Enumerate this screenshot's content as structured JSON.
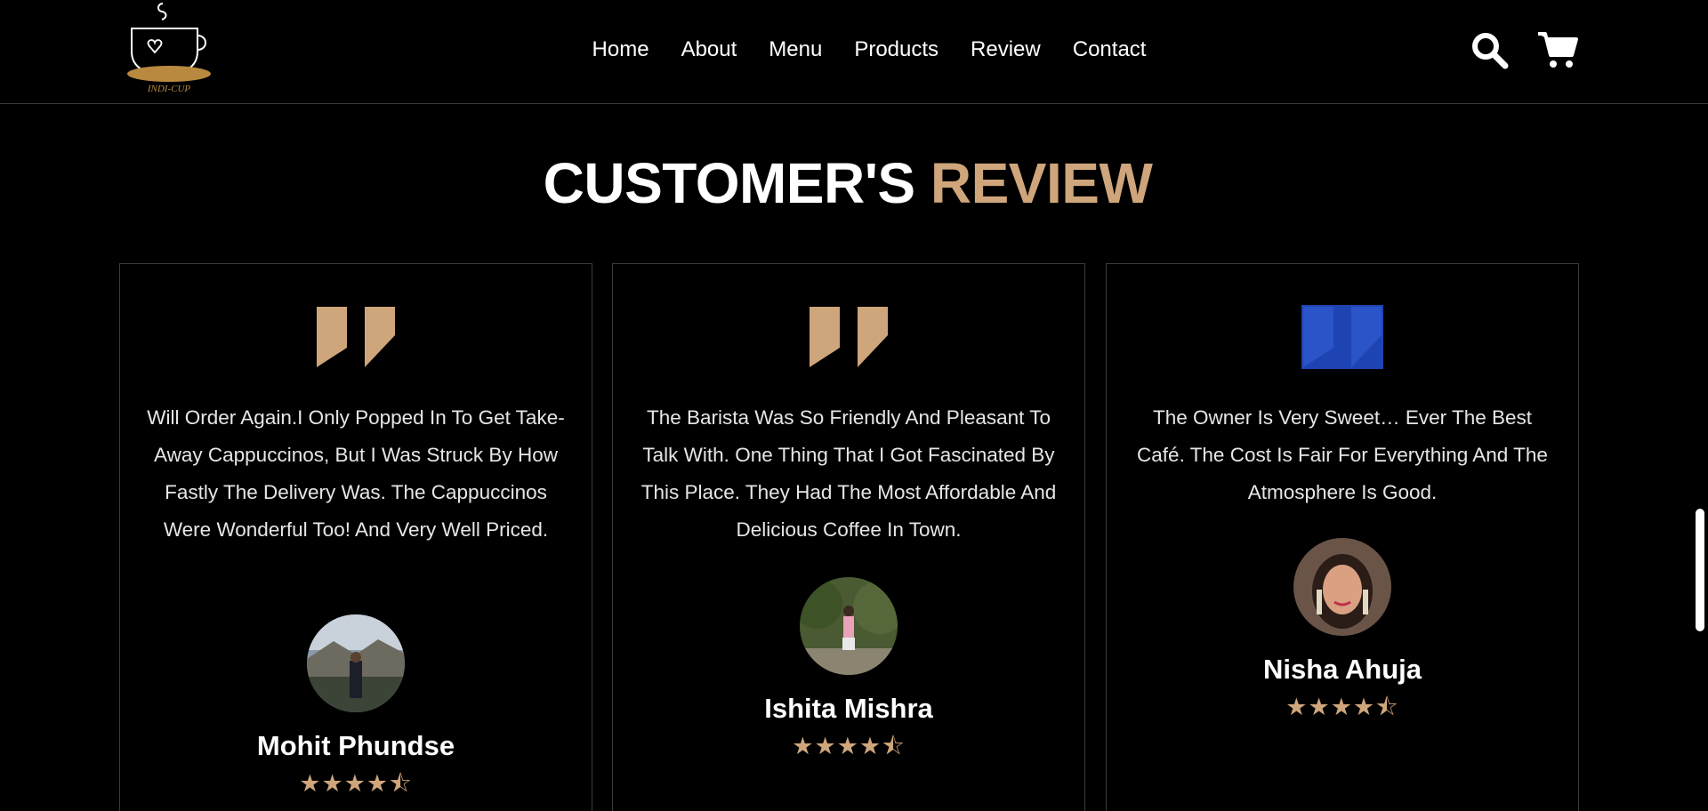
{
  "header": {
    "logo_text": "INDI-CUP",
    "nav": [
      "Home",
      "About",
      "Menu",
      "Products",
      "Review",
      "Contact"
    ],
    "search_icon": "search-icon",
    "cart_icon": "cart-icon"
  },
  "section": {
    "title_main": "CUSTOMER'S",
    "title_accent": "REVIEW"
  },
  "colors": {
    "background": "#000000",
    "accent": "#cfa57b",
    "quote_highlighted": "#1e44b4"
  },
  "reviews": [
    {
      "text": "Will Order Again.I Only Popped In To Get Take-Away Cappuccinos, But I Was Struck By How Fastly The Delivery Was. The Cappuccinos Were Wonderful Too! And Very Well Priced.",
      "name": "Mohit Phundse",
      "rating": 4.5
    },
    {
      "text": "The Barista Was So Friendly And Pleasant To Talk With. One Thing That I Got Fascinated By This Place. They Had The Most Affordable And Delicious Coffee In Town.",
      "name": "Ishita Mishra",
      "rating": 4.5
    },
    {
      "text": "The Owner Is Very Sweet… Ever The Best Café. The Cost Is Fair For Everything And The Atmosphere Is Good.",
      "name": "Nisha Ahuja",
      "rating": 4.5
    }
  ]
}
